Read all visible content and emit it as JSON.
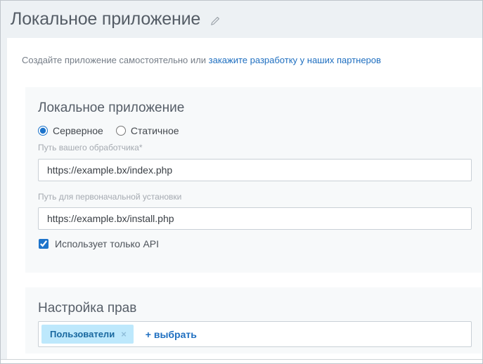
{
  "colors": {
    "header_bg": "#edf1f4",
    "card_bg": "#f7f9fa",
    "accent_blue": "#1d74cb",
    "link_blue": "#1f6fc0",
    "tag_bg": "#bde8fc",
    "tag_text": "#19689f",
    "border": "#c9d0d6"
  },
  "header": {
    "title": "Локальное приложение",
    "edit_icon": "pencil-icon"
  },
  "intro": {
    "text": "Создайте приложение самостоятельно или ",
    "link": "закажите разработку у наших партнеров"
  },
  "app_card": {
    "heading": "Локальное приложение",
    "radios": [
      {
        "label": "Серверное",
        "checked": true
      },
      {
        "label": "Статичное",
        "checked": false
      }
    ],
    "fields": [
      {
        "label": "Путь вашего обработчика*",
        "value": "https://example.bx/index.php"
      },
      {
        "label": "Путь для первоначальной установки",
        "value": "https://example.bx/install.php"
      }
    ],
    "checkbox": {
      "label": "Использует только API",
      "checked": true
    }
  },
  "permissions_card": {
    "heading": "Настройка прав",
    "tag": {
      "label": "Пользователи",
      "remove_glyph": "×"
    },
    "add_link": "+ выбрать"
  }
}
